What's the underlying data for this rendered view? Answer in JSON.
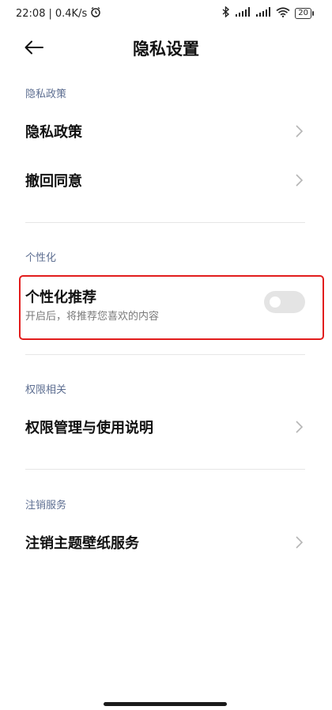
{
  "status_bar": {
    "time": "22:08",
    "speed": "0.4K/s",
    "battery": "20"
  },
  "header": {
    "title": "隐私设置"
  },
  "sections": {
    "privacy": {
      "title": "隐私政策",
      "items": [
        {
          "label": "隐私政策"
        },
        {
          "label": "撤回同意"
        }
      ]
    },
    "personalization": {
      "title": "个性化",
      "recommend_title": "个性化推荐",
      "recommend_desc": "开启后，将推荐您喜欢的内容",
      "recommend_enabled": false
    },
    "permissions": {
      "title": "权限相关",
      "items": [
        {
          "label": "权限管理与使用说明"
        }
      ]
    },
    "account": {
      "title": "注销服务",
      "items": [
        {
          "label": "注销主题壁纸服务"
        }
      ]
    }
  },
  "colors": {
    "section_title": "#5d6e91",
    "highlight_border": "#e21d1d",
    "toggle_off": "#e4e4e4"
  }
}
